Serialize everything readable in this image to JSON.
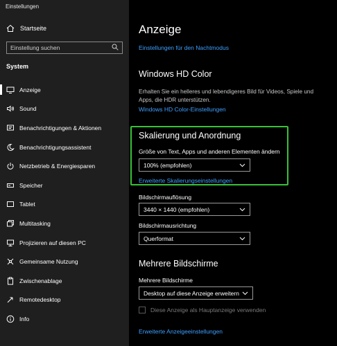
{
  "window": {
    "title": "Einstellungen"
  },
  "sidebar": {
    "home_label": "Startseite",
    "search_placeholder": "Einstellung suchen",
    "section_label": "System",
    "items": [
      {
        "label": "Anzeige",
        "icon": "monitor-icon"
      },
      {
        "label": "Sound",
        "icon": "speaker-icon"
      },
      {
        "label": "Benachrichtigungen & Aktionen",
        "icon": "notification-icon"
      },
      {
        "label": "Benachrichtigungsassistent",
        "icon": "moon-icon"
      },
      {
        "label": "Netzbetrieb & Energiesparen",
        "icon": "power-icon"
      },
      {
        "label": "Speicher",
        "icon": "storage-icon"
      },
      {
        "label": "Tablet",
        "icon": "tablet-icon"
      },
      {
        "label": "Multitasking",
        "icon": "multitasking-icon"
      },
      {
        "label": "Projizieren auf diesen PC",
        "icon": "project-icon"
      },
      {
        "label": "Gemeinsame Nutzung",
        "icon": "share-icon"
      },
      {
        "label": "Zwischenablage",
        "icon": "clipboard-icon"
      },
      {
        "label": "Remotedesktop",
        "icon": "remote-desktop-icon"
      },
      {
        "label": "Info",
        "icon": "info-icon"
      }
    ]
  },
  "main": {
    "title": "Anzeige",
    "night_mode_link": "Einstellungen für den Nachtmodus",
    "hd_color": {
      "heading": "Windows HD Color",
      "description": "Erhalten Sie ein helleres und lebendigeres Bild für Videos, Spiele und Apps, die HDR unterstützen.",
      "link": "Windows HD Color-Einstellungen"
    },
    "scaling": {
      "heading": "Skalierung und Anordnung",
      "size_label": "Größe von Text, Apps und anderen Elementen ändern",
      "size_value": "100% (empfohlen)",
      "advanced_link": "Erweiterte Skalierungseinstellungen",
      "resolution_label": "Bildschirmauflösung",
      "resolution_value": "3440 × 1440 (empfohlen)",
      "orientation_label": "Bildschirmausrichtung",
      "orientation_value": "Querformat"
    },
    "multi": {
      "heading": "Mehrere Bildschirme",
      "label": "Mehrere Bildschirme",
      "value": "Desktop auf diese Anzeige erweitern",
      "primary_checkbox": "Diese Anzeige als Hauptanzeige verwenden",
      "advanced_link": "Erweiterte Anzeigeeinstellungen"
    }
  },
  "colors": {
    "accent": "#3ea0ff",
    "highlight": "#38c338",
    "sidebar_bg": "#1f1f1f"
  }
}
